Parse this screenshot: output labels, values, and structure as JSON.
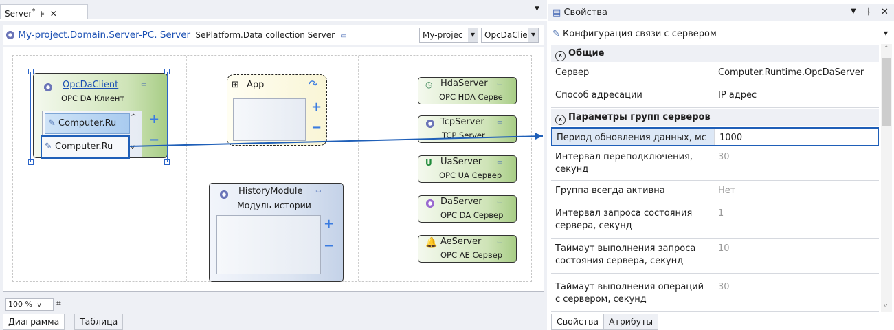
{
  "doc_tab": {
    "title": "Server",
    "modified_mark": "*",
    "pin": "⊧",
    "close": "✕"
  },
  "breadcrumb": {
    "path": "My-project.Domain.Server-PC.",
    "node": "Server",
    "type": "SePlatform.Data collection Server"
  },
  "combos": [
    {
      "value": "My-projec"
    },
    {
      "value": "OpcDaClie"
    }
  ],
  "nodes": {
    "opcda": {
      "name": "OpcDaClient",
      "subtitle": "OPC DA Клиент",
      "items": [
        "Computer.Ru",
        "Computer.Ru"
      ]
    },
    "app": {
      "name": "App"
    },
    "history": {
      "name": "HistoryModule",
      "subtitle": "Модуль истории"
    },
    "servers": [
      {
        "name": "HdaServer",
        "subtitle": "OPC HDA Серве"
      },
      {
        "name": "TcpServer",
        "subtitle": "TCP Server"
      },
      {
        "name": "UaServer",
        "subtitle": "OPC UA Сервер"
      },
      {
        "name": "DaServer",
        "subtitle": "OPC DA Сервер"
      },
      {
        "name": "AeServer",
        "subtitle": "OPC AE Сервер"
      }
    ]
  },
  "zoom": {
    "value": "100 %"
  },
  "bottom_tabs": [
    "Диаграмма",
    "Таблица"
  ],
  "properties": {
    "title": "Свойства",
    "subject": "Конфигурация связи с сервером",
    "sections": [
      {
        "label": "Общие"
      },
      {
        "label": "Параметры групп серверов"
      }
    ],
    "rows_general": [
      {
        "key": "Сервер",
        "value": "Computer.Runtime.OpcDaServer"
      },
      {
        "key": "Способ адресации",
        "value": "IP адрес"
      }
    ],
    "rows_groups": [
      {
        "key": "Период обновления данных, мс",
        "value": "1000"
      },
      {
        "key": "Интервал переподключения, секунд",
        "value": "30"
      },
      {
        "key": "Группа всегда активна",
        "value": "Нет"
      },
      {
        "key": "Интервал запроса состояния сервера, секунд",
        "value": "1"
      },
      {
        "key": "Таймаут выполнения запроса состояния сервера, секунд",
        "value": "10"
      },
      {
        "key": "Таймаут выполнения операций с сервером, секунд",
        "value": "30"
      }
    ],
    "bottom_tabs": [
      "Свойства",
      "Атрибуты"
    ]
  }
}
